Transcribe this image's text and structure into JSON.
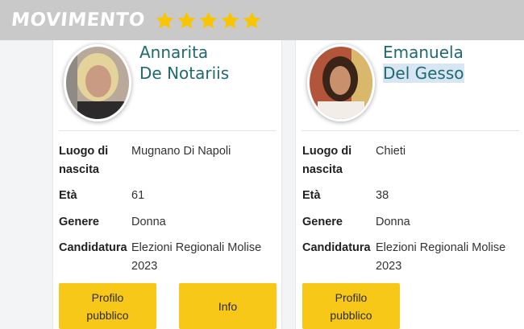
{
  "header": {
    "logo_text": "MOVIMENTO",
    "stars": [
      "star-icon",
      "star-icon",
      "star-icon",
      "star-icon",
      "star-icon"
    ],
    "bar_color": "#c9c9c9",
    "star_color": "#f7c600"
  },
  "candidates": [
    {
      "first_name": "Annarita",
      "last_name": "De Notariis",
      "fields": {
        "birthplace_label_1": "Luogo di",
        "birthplace_label_2": "nascita",
        "birthplace_value": "Mugnano Di Napoli",
        "age_label": "Età",
        "age_value": "61",
        "gender_label": "Genere",
        "gender_value": "Donna",
        "candidacy_label": "Candidatura",
        "candidacy_value_1": "Elezioni Regionali Molise",
        "candidacy_value_2": "2023"
      },
      "buttons": {
        "profile_1": "Profilo",
        "profile_2": "pubblico",
        "info": "Info"
      }
    },
    {
      "first_name": "Emanuela",
      "last_name": "Del Gesso",
      "fields": {
        "birthplace_label_1": "Luogo di",
        "birthplace_label_2": "nascita",
        "birthplace_value": "Chieti",
        "age_label": "Età",
        "age_value": "38",
        "gender_label": "Genere",
        "gender_value": "Donna",
        "candidacy_label": "Candidatura",
        "candidacy_value_1": "Elezioni Regionali Molise",
        "candidacy_value_2": "2023"
      },
      "buttons": {
        "profile_1": "Profilo",
        "profile_2": "pubblico"
      }
    }
  ],
  "colors": {
    "name": "#1f6a70",
    "button": "#f7c817",
    "selection_highlight": "#d8e6f4"
  }
}
